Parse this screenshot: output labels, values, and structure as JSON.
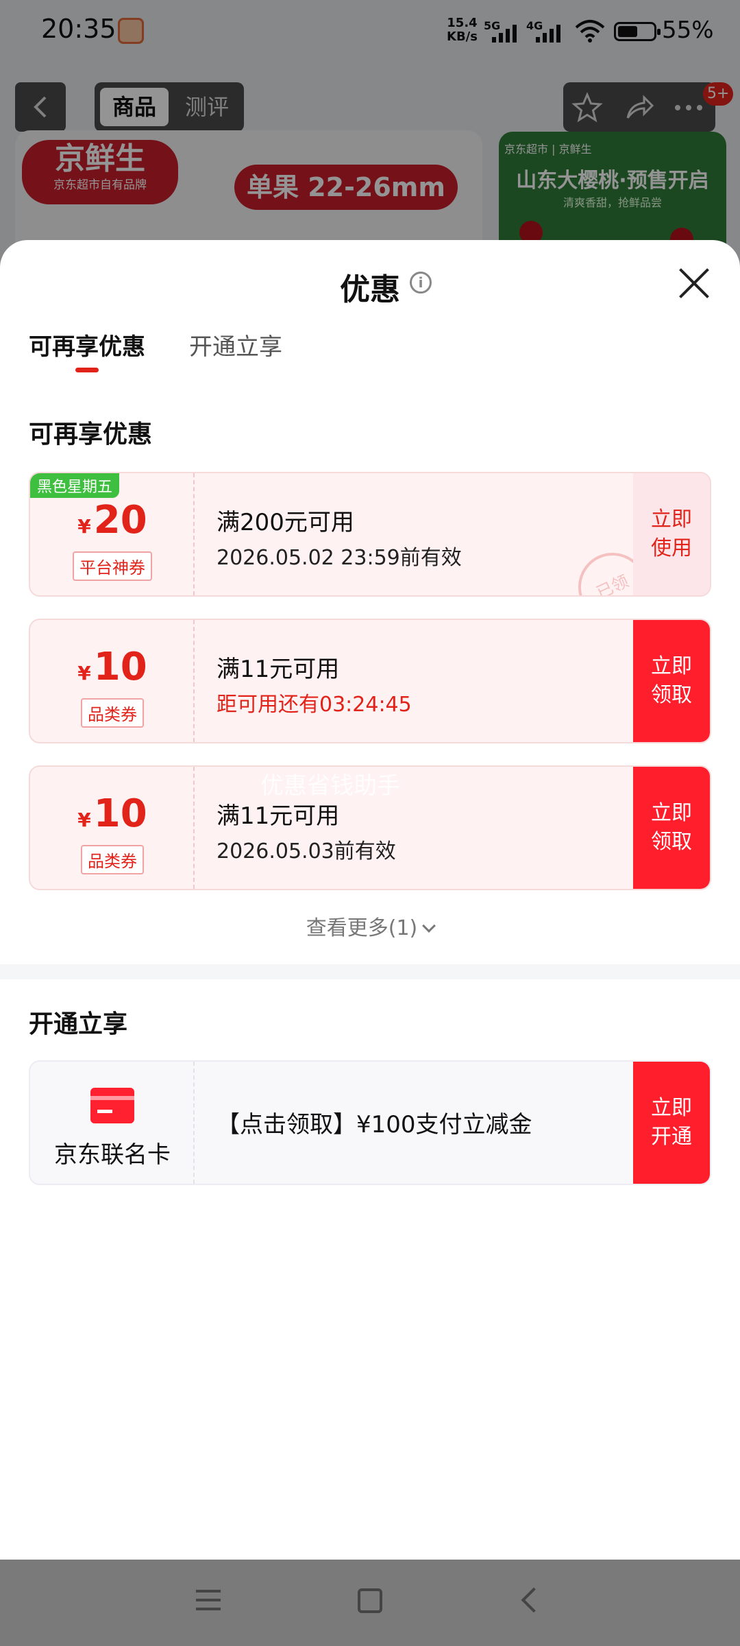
{
  "status": {
    "time": "20:35",
    "net_speed_value": "15.4",
    "net_speed_unit": "KB/s",
    "signal_1": "5G",
    "signal_2": "4G",
    "battery": "55%"
  },
  "product_nav": {
    "tab_goods": "商品",
    "tab_review": "测评",
    "badge": "5+"
  },
  "product": {
    "brand": "京鲜生",
    "brand_sub": "京东超市自有品牌",
    "size": "单果 22-26mm",
    "promo_header": "京东超市 | 京鲜生",
    "promo_title": "山东大樱桃·预售开启",
    "promo_sub": "清爽香甜，抢鲜品尝"
  },
  "sheet": {
    "title": "优惠",
    "tabs": {
      "available": "可再享优惠",
      "activate": "开通立享"
    },
    "section_available": "可再享优惠",
    "section_activate": "开通立享",
    "see_more": "查看更多(1)",
    "watermark": "优惠省钱助手"
  },
  "coupons": [
    {
      "tag": "黑色星期五",
      "currency": "¥",
      "amount": "20",
      "type": "平台神券",
      "condition": "满200元可用",
      "validity": "2026.05.02 23:59前有效",
      "button": "立即使用",
      "stamp": "已领"
    },
    {
      "currency": "¥",
      "amount": "10",
      "type": "品类券",
      "condition": "满11元可用",
      "validity": "距可用还有03:24:45",
      "button": "立即领取"
    },
    {
      "currency": "¥",
      "amount": "10",
      "type": "品类券",
      "condition": "满11元可用",
      "validity": "2026.05.03前有效",
      "button": "立即领取"
    }
  ],
  "card_offer": {
    "name": "京东联名卡",
    "description": "【点击领取】¥100支付立减金",
    "button": "立即开通"
  },
  "colors": {
    "accent_red": "#e2231a",
    "button_red": "#ff1e2c",
    "tag_green": "#3fbf3f"
  }
}
